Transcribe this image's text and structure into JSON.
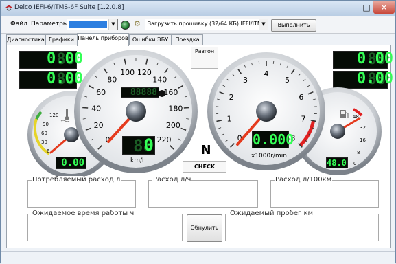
{
  "window": {
    "title": "Delco IEFI-6/ITMS-6F Suite [1.2.0.8]",
    "minimize_glyph": "–",
    "maximize_glyph": "□",
    "close_glyph": "✕"
  },
  "toolbar": {
    "menu_file": "Файл",
    "menu_params": "Параметры",
    "color_combo_value": "",
    "firmware_combo_value": "Загрузить прошивку (32/64 КБ) IEFI/ITMS",
    "execute_label": "Выполнить"
  },
  "tabs": [
    "Диагностика",
    "Графики",
    "Панель приборов",
    "Ошибки ЭБУ",
    "Поездка"
  ],
  "dashboard": {
    "left_displays": [
      "0.00",
      "0.00"
    ],
    "right_displays": [
      "0.00",
      "0.00"
    ],
    "acceleration_label": "Разгон",
    "coolant": {
      "ticks": [
        "6",
        "30",
        "60",
        "90",
        "120"
      ],
      "digital_value": "0.00"
    },
    "speedometer": {
      "ticks": [
        "0",
        "20",
        "40",
        "60",
        "80",
        "100",
        "120",
        "140",
        "160",
        "180",
        "200",
        "220"
      ],
      "unit": "km/h",
      "odometer": "88888",
      "digital_speed": "0"
    },
    "tachometer": {
      "ticks": [
        "0",
        "1",
        "2",
        "3",
        "4",
        "5",
        "6",
        "7",
        "8"
      ],
      "unit": "x1000r/min",
      "digital_rpm": "0.000"
    },
    "fuel": {
      "ticks": [
        "0",
        "8",
        "16",
        "32",
        "48"
      ],
      "digital_value": "48.0"
    },
    "gear_indicator": "N",
    "check_label": "CHECK",
    "consumption_label": "Потребляемый расход л",
    "rate_lh_label": "Расход л/ч",
    "rate_l100_label": "Расход л/100км",
    "expected_time_label": "Ожидаемое время работы ч",
    "reset_label": "Обнулить",
    "expected_range_label": "Ожидаемый пробег км"
  },
  "colors": {
    "lcd_green": "#33ff55",
    "needle_red": "#e53b1e",
    "redzone": "#e02020",
    "close_red": "#c7473a"
  }
}
